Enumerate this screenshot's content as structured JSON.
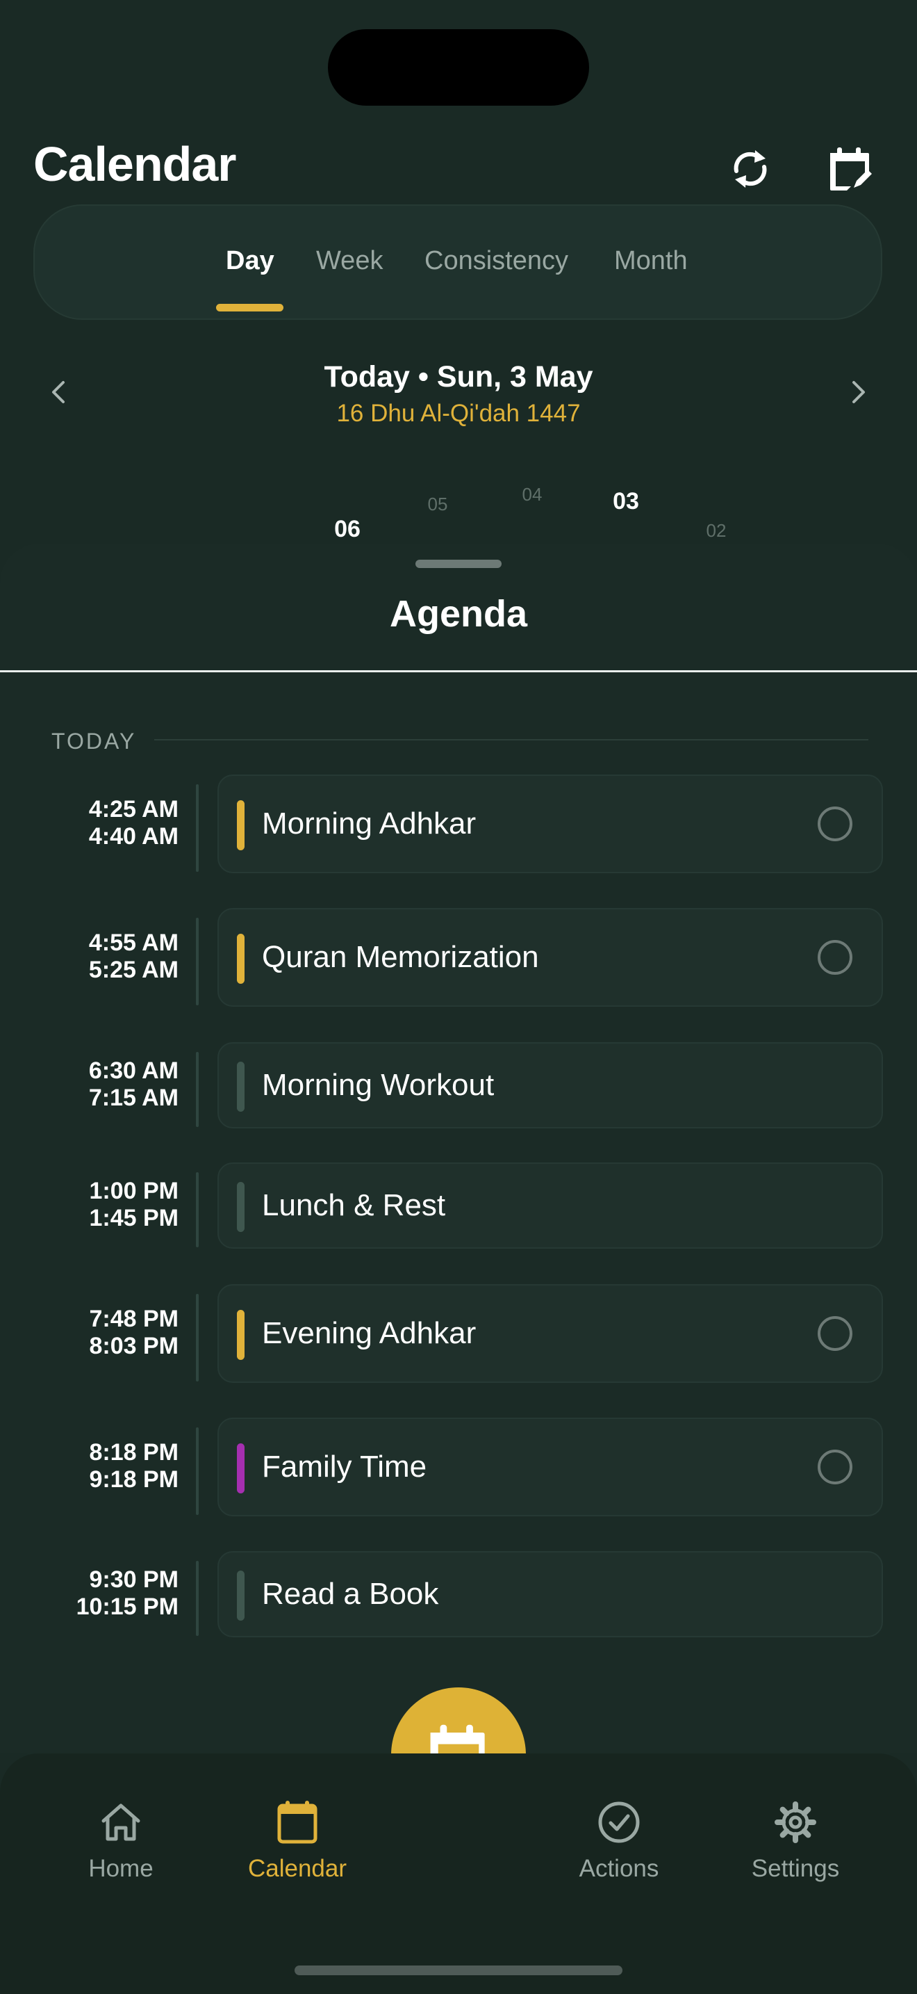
{
  "header": {
    "title": "Calendar",
    "icons": [
      "sync-icon",
      "calendar-edit-icon"
    ]
  },
  "tabs": [
    {
      "label": "Day",
      "active": true
    },
    {
      "label": "Week",
      "active": false
    },
    {
      "label": "Consistency",
      "active": false
    },
    {
      "label": "Month",
      "active": false
    }
  ],
  "date_header": {
    "title": "Today • Sun, 3 May",
    "hijri": "16 Dhu Al-Qi'dah 1447"
  },
  "day_picker": {
    "numbers": [
      "06",
      "05",
      "04",
      "03",
      "02"
    ]
  },
  "agenda": {
    "title": "Agenda",
    "section_label": "TODAY",
    "events": [
      {
        "start": "4:25 AM",
        "end": "4:40 AM",
        "title": "Morning Adhkar",
        "accent": "#e0b23a",
        "checkable": true
      },
      {
        "start": "4:55 AM",
        "end": "5:25 AM",
        "title": "Quran Memorization",
        "accent": "#e0b23a",
        "checkable": true
      },
      {
        "start": "6:30 AM",
        "end": "7:15 AM",
        "title": "Morning Workout",
        "accent": "#3f574f",
        "checkable": false
      },
      {
        "start": "1:00 PM",
        "end": "1:45 PM",
        "title": "Lunch & Rest",
        "accent": "#3f574f",
        "checkable": false
      },
      {
        "start": "7:48 PM",
        "end": "8:03 PM",
        "title": "Evening Adhkar",
        "accent": "#e0b23a",
        "checkable": true
      },
      {
        "start": "8:18 PM",
        "end": "9:18 PM",
        "title": "Family Time",
        "accent": "#a52fb0",
        "checkable": true
      },
      {
        "start": "9:30 PM",
        "end": "10:15 PM",
        "title": "Read a Book",
        "accent": "#3f574f",
        "checkable": false
      }
    ]
  },
  "bottom_nav": [
    {
      "label": "Home",
      "icon": "home-icon",
      "active": false
    },
    {
      "label": "Calendar",
      "icon": "calendar-icon",
      "active": true
    },
    {
      "label": "Actions",
      "icon": "check-circle-icon",
      "active": false
    },
    {
      "label": "Settings",
      "icon": "gear-icon",
      "active": false
    }
  ],
  "fab": {
    "icon": "calendar-edit-icon"
  },
  "colors": {
    "background": "#1a2a25",
    "accent": "#e0b23a",
    "purple": "#a52fb0",
    "muted": "#3f574f"
  }
}
